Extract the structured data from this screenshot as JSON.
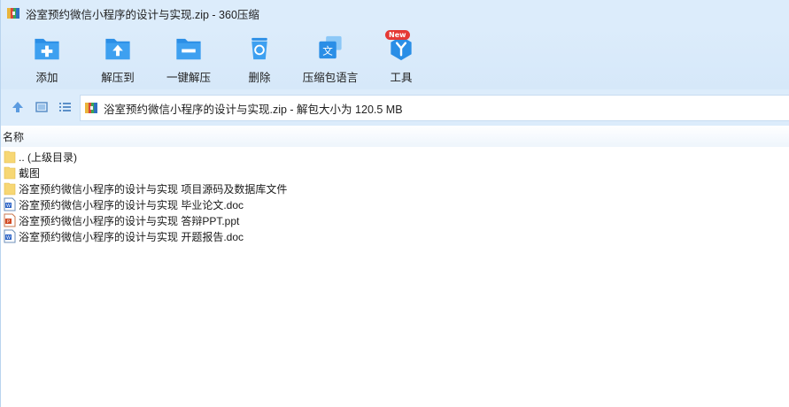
{
  "window": {
    "title": "浴室预约微信小程序的设计与实现.zip - 360压缩"
  },
  "toolbar": {
    "items": [
      {
        "label": "添加",
        "icon": "add-icon"
      },
      {
        "label": "解压到",
        "icon": "extract-to-icon"
      },
      {
        "label": "一键解压",
        "icon": "one-click-extract-icon"
      },
      {
        "label": "删除",
        "icon": "delete-icon"
      },
      {
        "label": "压缩包语言",
        "icon": "language-icon"
      },
      {
        "label": "工具",
        "icon": "tools-icon",
        "badge": "New"
      }
    ]
  },
  "address": {
    "path": "浴室预约微信小程序的设计与实现.zip - 解包大小为 120.5 MB"
  },
  "list": {
    "column_name": "名称",
    "items": [
      {
        "name": ".. (上级目录)",
        "type": "folder"
      },
      {
        "name": "截图",
        "type": "folder"
      },
      {
        "name": "浴室预约微信小程序的设计与实现 项目源码及数据库文件",
        "type": "folder"
      },
      {
        "name": "浴室预约微信小程序的设计与实现 毕业论文.doc",
        "type": "doc"
      },
      {
        "name": "浴室预约微信小程序的设计与实现 答辩PPT.ppt",
        "type": "ppt"
      },
      {
        "name": "浴室预约微信小程序的设计与实现 开题报告.doc",
        "type": "doc"
      }
    ]
  },
  "colors": {
    "accent": "#2a8ee6",
    "toolbar_bg": "#dcecfb",
    "folder": "#f7d774",
    "badge": "#e53935"
  }
}
